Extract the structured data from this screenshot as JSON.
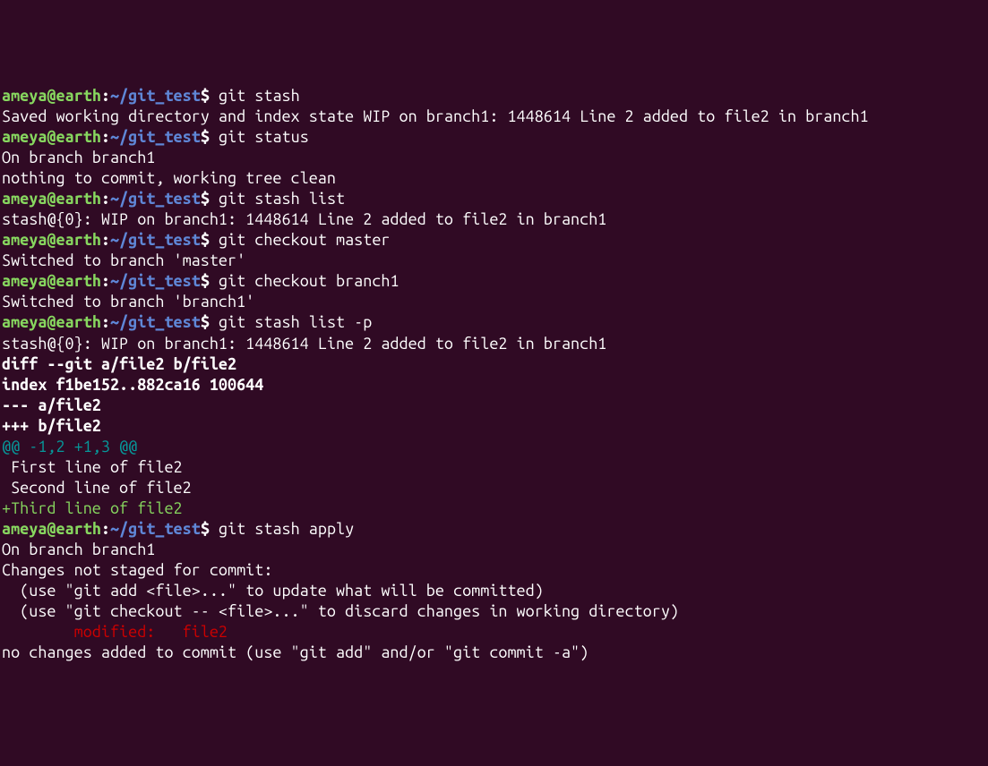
{
  "prompt": {
    "user": "ameya",
    "at": "@",
    "host": "earth",
    "colon": ":",
    "path": "~/git_test",
    "dollar": "$"
  },
  "lines": {
    "cmd1": " git stash",
    "out1": "Saved working directory and index state WIP on branch1: 1448614 Line 2 added to file2 in branch1",
    "cmd2": " git status",
    "out2a": "On branch branch1",
    "out2b": "nothing to commit, working tree clean",
    "cmd3": " git stash list",
    "out3": "stash@{0}: WIP on branch1: 1448614 Line 2 added to file2 in branch1",
    "cmd4": " git checkout master",
    "out4": "Switched to branch 'master'",
    "cmd5": " git checkout branch1",
    "out5": "Switched to branch 'branch1'",
    "cmd6": " git stash list -p",
    "out6": "stash@{0}: WIP on branch1: 1448614 Line 2 added to file2 in branch1",
    "blank": "",
    "diff1": "diff --git a/file2 b/file2",
    "diff2": "index f1be152..882ca16 100644",
    "diff3": "--- a/file2",
    "diff4": "+++ b/file2",
    "hunk1": "@@ -1,2 +1,3 @@",
    "ctx1": " First line of file2",
    "ctx2": " Second line of file2",
    "add1": "+Third line of file2",
    "cmd7": " git stash apply",
    "out7a": "On branch branch1",
    "out7b": "Changes not staged for commit:",
    "out7c": "  (use \"git add <file>...\" to update what will be committed)",
    "out7d": "  (use \"git checkout -- <file>...\" to discard changes in working directory)",
    "mod_indent": "        ",
    "mod_label": "modified:   file2",
    "out7f": "no changes added to commit (use \"git add\" and/or \"git commit -a\")"
  }
}
